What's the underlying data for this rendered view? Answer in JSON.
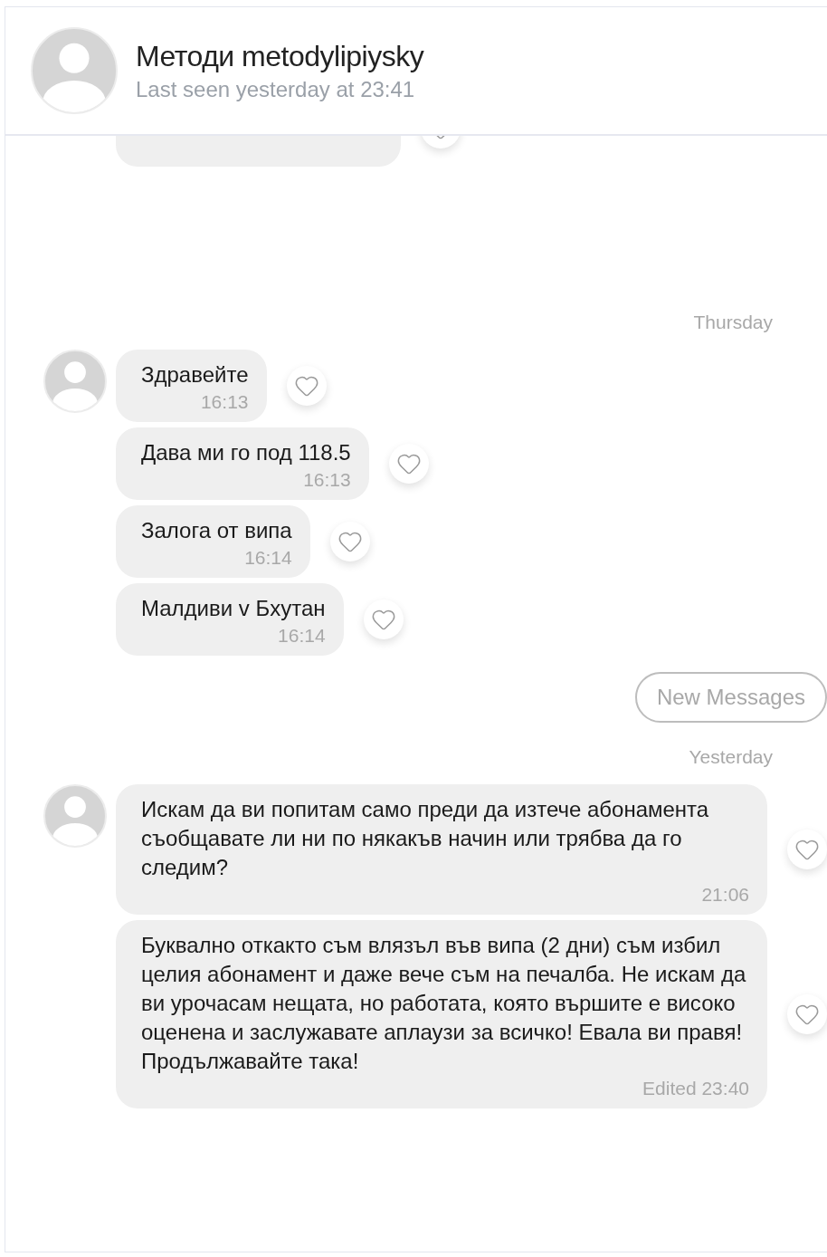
{
  "contact": {
    "name": "Методи metodylipiysky",
    "status": "Last seen yesterday at 23:41"
  },
  "feed": [
    {
      "kind": "date",
      "label": "Thursday"
    },
    {
      "kind": "group",
      "messages": [
        {
          "text": "Здравейте",
          "time": "16:13"
        },
        {
          "text": "Дава ми го под 118.5",
          "time": "16:13"
        },
        {
          "text": "Залога от випа",
          "time": "16:14"
        },
        {
          "text": "Малдиви v Бхутан",
          "time": "16:14"
        }
      ]
    },
    {
      "kind": "divider",
      "label": "New Messages"
    },
    {
      "kind": "date",
      "label": "Yesterday"
    },
    {
      "kind": "group",
      "messages": [
        {
          "text": "Искам да ви попитам само преди да изтече абонамента съобщавате ли ни по някакъв начин или трябва да го следим?",
          "time": "21:06"
        },
        {
          "text": "Буквално откакто съм влязъл във випа (2 дни) съм избил целия абонамент и даже вече съм на печалба. Не искам да ви урочасам нещата, но работата, която вършите е високо оценена и заслужавате аплаузи за всичко! Евала ви правя! Продължавайте така!",
          "time": "Edited 23:40"
        }
      ]
    }
  ]
}
